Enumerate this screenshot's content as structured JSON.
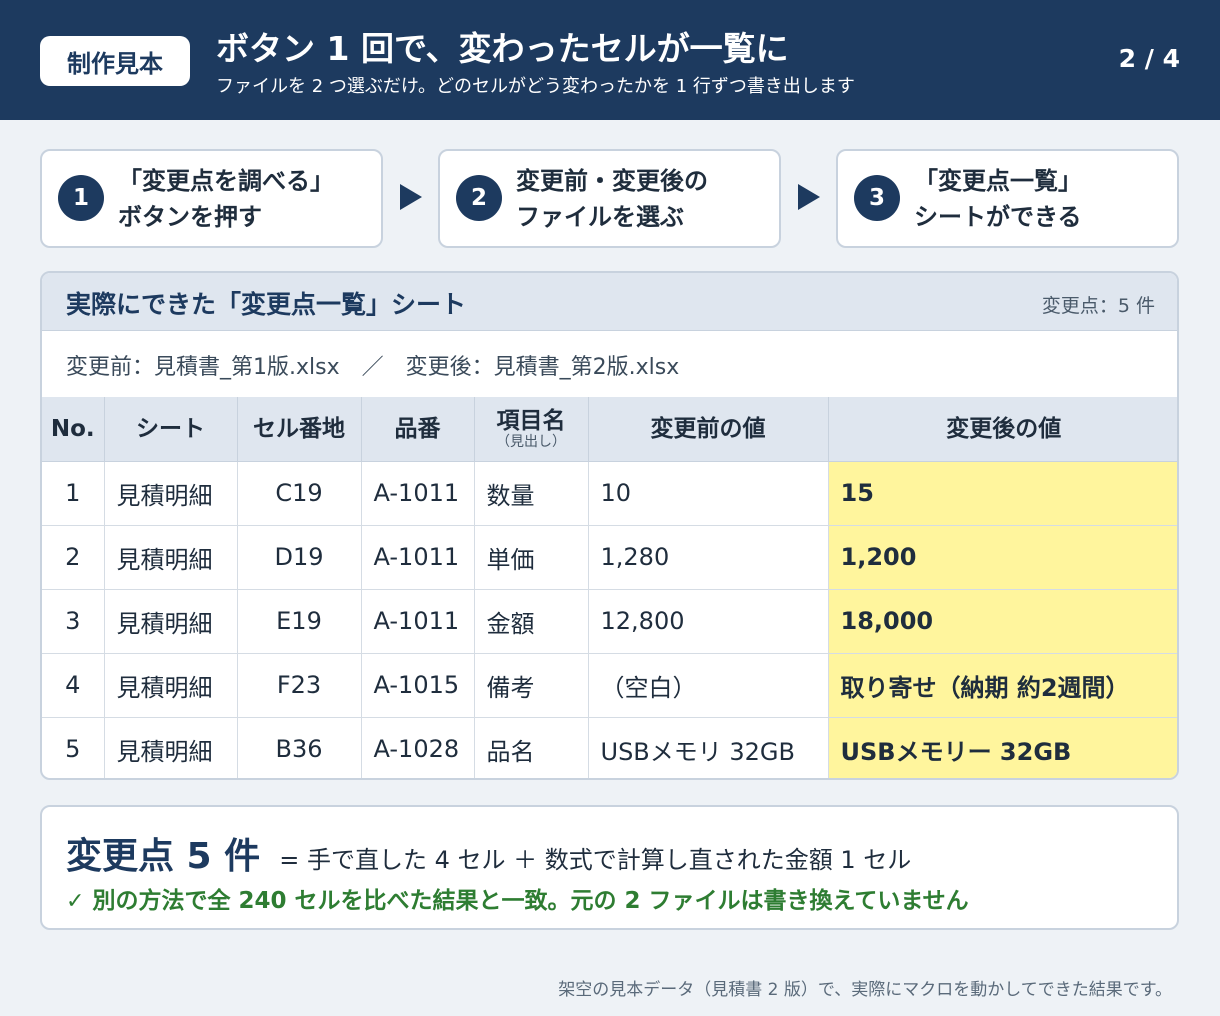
{
  "header": {
    "badge": "制作見本",
    "title": "ボタン 1 回で、変わったセルが一覧に",
    "subtitle": "ファイルを 2 つ選ぶだけ。どのセルがどう変わったかを 1 行ずつ書き出します",
    "page": "2 / 4"
  },
  "steps": [
    {
      "num": "1",
      "line1": "「変更点を調べる」",
      "line2": "ボタンを押す"
    },
    {
      "num": "2",
      "line1": "変更前・変更後の",
      "line2": "ファイルを選ぶ"
    },
    {
      "num": "3",
      "line1": "「変更点一覧」",
      "line2": "シートができる"
    }
  ],
  "panel": {
    "title": "実際にできた「変更点一覧」シート",
    "count": "変更点：5 件",
    "files": "変更前：見積書_第1版.xlsx　／　変更後：見積書_第2版.xlsx"
  },
  "table": {
    "headers": {
      "no": "No.",
      "sheet": "シート",
      "cell": "セル番地",
      "part": "品番",
      "item": "項目名",
      "item_sub": "（見出し）",
      "before": "変更前の値",
      "after": "変更後の値"
    },
    "rows": [
      {
        "no": "1",
        "sheet": "見積明細",
        "cell": "C19",
        "part": "A-1011",
        "item": "数量",
        "before": "10",
        "after": "15"
      },
      {
        "no": "2",
        "sheet": "見積明細",
        "cell": "D19",
        "part": "A-1011",
        "item": "単価",
        "before": "1,280",
        "after": "1,200"
      },
      {
        "no": "3",
        "sheet": "見積明細",
        "cell": "E19",
        "part": "A-1011",
        "item": "金額",
        "before": "12,800",
        "after": "18,000"
      },
      {
        "no": "4",
        "sheet": "見積明細",
        "cell": "F23",
        "part": "A-1015",
        "item": "備考",
        "before": "（空白）",
        "after": "取り寄せ（納期 約2週間）"
      },
      {
        "no": "5",
        "sheet": "見積明細",
        "cell": "B36",
        "part": "A-1028",
        "item": "品名",
        "before": "USBメモリ 32GB",
        "after": "USBメモリー 32GB"
      }
    ]
  },
  "summary": {
    "big": "変更点 5 件",
    "rest": "= 手で直した 4 セル ＋ 数式で計算し直された金額 1 セル",
    "check_mark": "✓",
    "check_text": "別の方法で全 240 セルを比べた結果と一致。元の 2 ファイルは書き換えていません"
  },
  "footer": "架空の見本データ（見積書 2 版）で、実際にマクロを動かしてできた結果です。"
}
